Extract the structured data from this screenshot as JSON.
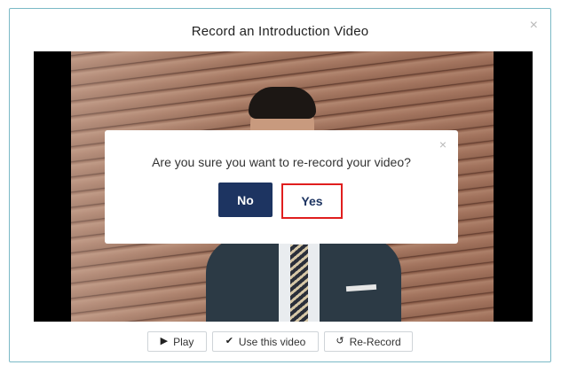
{
  "modal": {
    "title": "Record an Introduction Video",
    "close_icon": "×"
  },
  "confirm_dialog": {
    "message": "Are you sure you want to re-record your video?",
    "close_icon": "×",
    "no_label": "No",
    "yes_label": "Yes"
  },
  "controls": {
    "play": {
      "icon": "play-icon",
      "glyph": "▶",
      "label": "Play"
    },
    "use": {
      "icon": "check-icon",
      "glyph": "✔",
      "label": "Use this video"
    },
    "rerecord": {
      "icon": "rerecord-icon",
      "glyph": "↺",
      "label": "Re-Record"
    }
  },
  "colors": {
    "modal_border": "#7ab9c6",
    "primary": "#1d3461",
    "highlight": "#e01e1e"
  }
}
